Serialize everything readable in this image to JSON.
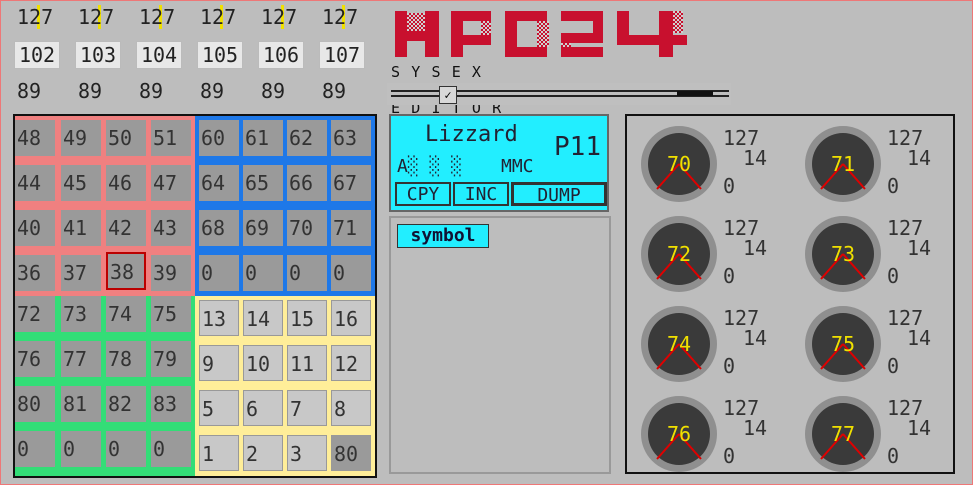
{
  "faders": [
    {
      "top": "127",
      "channel": "102",
      "bottom": "89"
    },
    {
      "top": "127",
      "channel": "103",
      "bottom": "89"
    },
    {
      "top": "127",
      "channel": "104",
      "bottom": "89"
    },
    {
      "top": "127",
      "channel": "105",
      "bottom": "89"
    },
    {
      "top": "127",
      "channel": "106",
      "bottom": "89"
    },
    {
      "top": "127",
      "channel": "107",
      "bottom": "89"
    }
  ],
  "logo": {
    "title": "MPD24",
    "subtitle": "SYSEX PATCH EDITOR",
    "title_color": "#c8102e"
  },
  "slider": {
    "knob_icon": "checkmark-icon",
    "knob_glyph": "✓"
  },
  "grid": {
    "red": [
      "48",
      "49",
      "50",
      "51",
      "44",
      "45",
      "46",
      "47",
      "40",
      "41",
      "42",
      "43",
      "36",
      "37",
      "38",
      "39"
    ],
    "blue": [
      "60",
      "61",
      "62",
      "63",
      "64",
      "65",
      "66",
      "67",
      "68",
      "69",
      "70",
      "71",
      "0",
      "0",
      "0",
      "0"
    ],
    "green": [
      "72",
      "73",
      "74",
      "75",
      "76",
      "77",
      "78",
      "79",
      "80",
      "81",
      "82",
      "83",
      "0",
      "0",
      "0",
      "0"
    ],
    "yellow": [
      "13",
      "14",
      "15",
      "16",
      "9",
      "10",
      "11",
      "12",
      "5",
      "6",
      "7",
      "8",
      "1",
      "2",
      "3",
      "80"
    ],
    "selected": "38"
  },
  "patch": {
    "name": "Lizzard",
    "number": "P11",
    "sub": "A░ ░ ░",
    "mmc": "MMC",
    "buttons": {
      "copy": "CPY",
      "inc": "INC",
      "dump": "DUMP"
    }
  },
  "symbol_button": "symbol",
  "knobs": [
    {
      "value": "70",
      "max": "127",
      "mid": "14",
      "min": "0"
    },
    {
      "value": "71",
      "max": "127",
      "mid": "14",
      "min": "0"
    },
    {
      "value": "72",
      "max": "127",
      "mid": "14",
      "min": "0"
    },
    {
      "value": "73",
      "max": "127",
      "mid": "14",
      "min": "0"
    },
    {
      "value": "74",
      "max": "127",
      "mid": "14",
      "min": "0"
    },
    {
      "value": "75",
      "max": "127",
      "mid": "14",
      "min": "0"
    },
    {
      "value": "76",
      "max": "127",
      "mid": "14",
      "min": "0"
    },
    {
      "value": "77",
      "max": "127",
      "mid": "14",
      "min": "0"
    }
  ],
  "colors": {
    "accent": "#22eeff",
    "knob_value": "#f0e000",
    "needle": "#e00000"
  }
}
